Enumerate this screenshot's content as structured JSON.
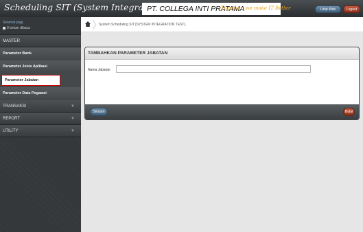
{
  "header": {
    "app_title": "Scheduling SIT (System Integration Test)",
    "brand_name": "PT. COLLEGA INTI PRATAMA",
    "brand_tagline": "Together, we make IT Better",
    "lihat_web_label": "Lihat Web",
    "logout_label": "Logout",
    "accent_color": "#e8a21a"
  },
  "sidebar": {
    "user_label": "Selamat pagi,",
    "user_status": "0 belum dibaca",
    "sections": [
      {
        "label": "MASTER"
      },
      {
        "label": "TRANSAKSI"
      },
      {
        "label": "REPORT"
      },
      {
        "label": "UTILITY"
      }
    ],
    "master_items": [
      {
        "label": "Parameter Bank"
      },
      {
        "label": "Parameter Jenis Aplikasi"
      },
      {
        "label": "Parameter Jabatan"
      },
      {
        "label": "Parameter Data Pegawai"
      }
    ],
    "caret": "▼"
  },
  "main": {
    "breadcrumb": "System Scheduling SIT [SYSTEM INTEGRATION TEST].",
    "form": {
      "title": "TAMBAHKAN PARAMETER JABATAN",
      "field_label": "Nama Jabatan",
      "field_value": "",
      "save_label": "Simpan",
      "cancel_label": "Batal"
    }
  }
}
